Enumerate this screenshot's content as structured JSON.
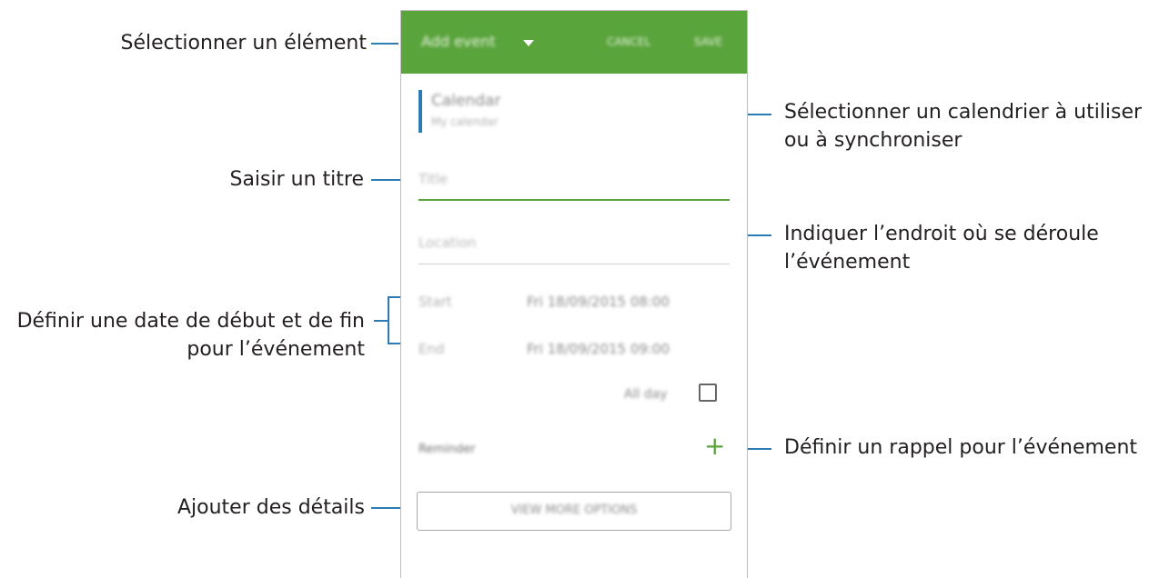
{
  "callouts": {
    "select_item": "Sélectionner un élément",
    "enter_title": "Saisir un titre",
    "start_end_line1": "Définir une date de début et de fin",
    "start_end_line2": "pour l’événement",
    "add_details": "Ajouter des détails",
    "calendar_line1": "Sélectionner un calendrier à utiliser",
    "calendar_line2": "ou à synchroniser",
    "location_line1": "Indiquer l’endroit où se déroule",
    "location_line2": "l’événement",
    "reminder": "Définir un rappel pour l’événement"
  },
  "appbar": {
    "title": "Add event",
    "cancel": "CANCEL",
    "save": "SAVE",
    "color": "#5aa43c"
  },
  "calendar": {
    "label": "Calendar",
    "sub": "My calendar",
    "accent": "#2b7cb5"
  },
  "title_field": {
    "placeholder": "Title"
  },
  "location_field": {
    "placeholder": "Location"
  },
  "start": {
    "label": "Start",
    "value": "Fri 18/09/2015  08:00"
  },
  "end": {
    "label": "End",
    "value": "Fri 18/09/2015  09:00"
  },
  "all_day": {
    "label": "All day",
    "checked": false
  },
  "reminder": {
    "label": "Reminder",
    "icon": "plus-icon"
  },
  "more_options": {
    "label": "VIEW MORE OPTIONS"
  }
}
